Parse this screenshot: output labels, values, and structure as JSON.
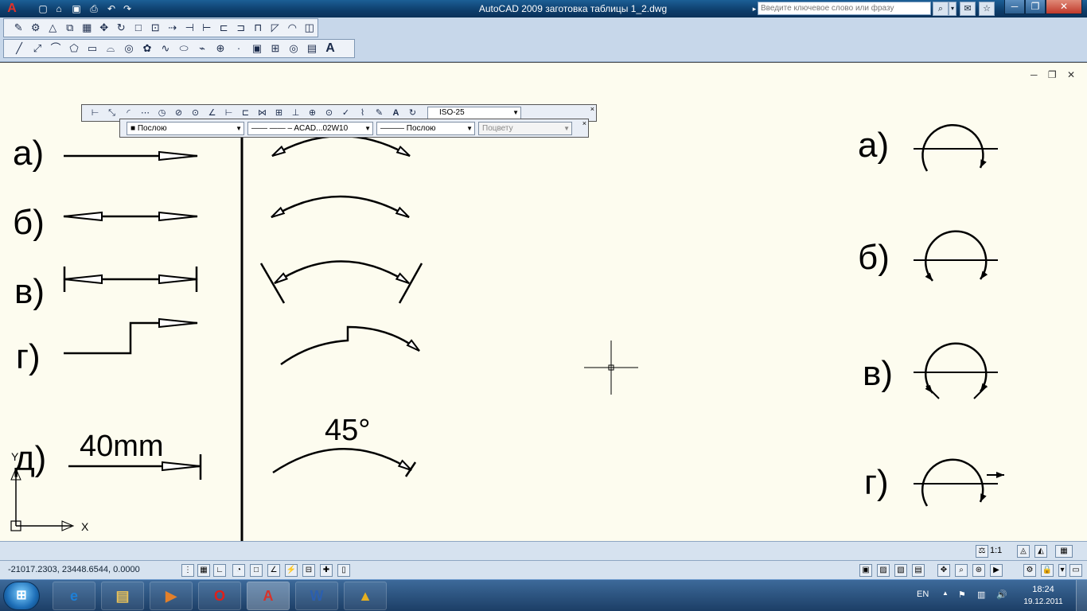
{
  "window": {
    "title": "AutoCAD 2009 заготовка таблицы 1_2.dwg",
    "search_placeholder": "Введите ключевое слово или фразу",
    "minimize": "─",
    "maximize": "❐",
    "close": "✕"
  },
  "toolbars": {
    "modify": [
      "✎",
      "⚙",
      "△",
      "⧉",
      "▦",
      "✥",
      "↻",
      "□",
      "⊡",
      "⇢",
      "⊣",
      "⊢",
      "⊏",
      "⊐",
      "⊓",
      "◸",
      "◠",
      "◫"
    ],
    "draw": [
      "╱",
      "⤢",
      "⌒",
      "⬠",
      "▭",
      "⌓",
      "◎",
      "✿",
      "∿",
      "⬭",
      "⌁",
      "⊕",
      "·",
      "▣",
      "⊞",
      "◎",
      "▤",
      "A"
    ]
  },
  "dim_toolbar": {
    "tools": [
      "⊢",
      "⤡",
      "◜",
      "⋯",
      "◷",
      "⊘",
      "⊙",
      "∠",
      "⊢",
      "⊏",
      "⋈",
      "⊞",
      "⊥",
      "⊕",
      "⊙",
      "✓",
      "⌇",
      "✎",
      "A",
      "↻"
    ],
    "style": "ISO-25",
    "close": "×"
  },
  "properties_toolbar": {
    "color": "■ Послою",
    "linetype": "—— —— –  ACAD...02W10",
    "lineweight": "——— Послою",
    "plotstyle": "Поцвету",
    "close": "×"
  },
  "drawing": {
    "doc_controls": "─ ❐ ✕",
    "left_labels": [
      "а)",
      "б)",
      "в)",
      "г)",
      "д)"
    ],
    "dim_text_mm": "40mm",
    "dim_text_angle": "45°",
    "right_labels": [
      "а)",
      "б)",
      "в)",
      "г)"
    ],
    "ucs_x": "X",
    "ucs_y": "Y"
  },
  "statusbar": {
    "coordinates": "-21017.2303, 23448.6544, 0.0000",
    "scale": "1:1"
  },
  "taskbar": {
    "start": "⊞",
    "language": "EN",
    "time": "18:24",
    "date": "19.12.2011",
    "apps": [
      {
        "name": "internet-explorer",
        "glyph": "e",
        "color": "#1e7fd6"
      },
      {
        "name": "file-explorer",
        "glyph": "▤",
        "color": "#e9c25a"
      },
      {
        "name": "media-player",
        "glyph": "▶",
        "color": "#e3802a"
      },
      {
        "name": "opera",
        "glyph": "O",
        "color": "#e0201a"
      },
      {
        "name": "autocad",
        "glyph": "A",
        "color": "#d8322a"
      },
      {
        "name": "word",
        "glyph": "W",
        "color": "#2b5faf"
      },
      {
        "name": "autocad-alt",
        "glyph": "▲",
        "color": "#e6b020"
      }
    ]
  }
}
